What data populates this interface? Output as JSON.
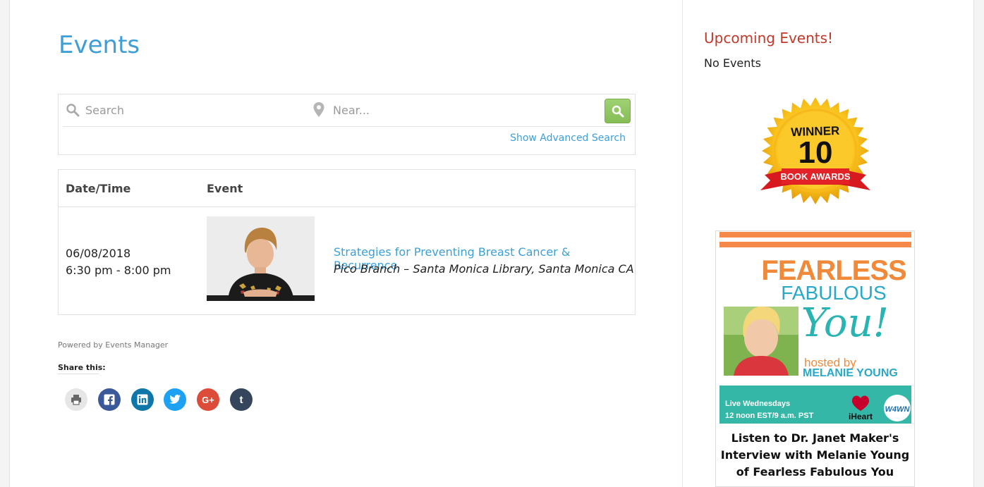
{
  "main": {
    "title": "Events",
    "search": {
      "placeholder": "Search",
      "near_placeholder": "Near...",
      "advanced_link": "Show Advanced Search"
    },
    "table": {
      "headers": [
        "Date/Time",
        "Event"
      ],
      "rows": [
        {
          "date": "06/08/2018",
          "time": "6:30 pm - 8:00 pm",
          "title": "Strategies for Preventing Breast Cancer & Recurrence",
          "location": "Pico Branch – Santa Monica Library, Santa Monica CA"
        }
      ]
    },
    "powered_by": "Powered by Events Manager",
    "share": {
      "title": "Share this:",
      "buttons": [
        {
          "name": "print",
          "color": "#e6e6e6"
        },
        {
          "name": "facebook",
          "color": "#3b5998"
        },
        {
          "name": "linkedin",
          "color": "#0e76a8"
        },
        {
          "name": "twitter",
          "color": "#1da1f2"
        },
        {
          "name": "google-plus",
          "color": "#dd4b39"
        },
        {
          "name": "tumblr",
          "color": "#35465c"
        }
      ]
    }
  },
  "sidebar": {
    "widget_title": "Upcoming Events!",
    "no_events": "No Events",
    "badge": {
      "top": "WINNER",
      "number": "10",
      "ribbon": "BOOK AWARDS"
    },
    "promo": {
      "line1": "FEARLESS",
      "line2": "FABULOUS",
      "line3": "You!",
      "hosted": "hosted by",
      "host": "MELANIE YOUNG",
      "live": "Live Wednesdays",
      "time": "12 noon EST/9 a.m. PST",
      "iheart": "iHeart",
      "w4wn": "W4WN",
      "caption_lines": [
        "Listen to Dr. Janet Maker's",
        "Interview with Melanie Young",
        "of Fearless Fabulous You"
      ]
    }
  },
  "colors": {
    "link": "#3e9fd6",
    "widget_title": "#c0392b",
    "search_button": "#8cc25d"
  }
}
